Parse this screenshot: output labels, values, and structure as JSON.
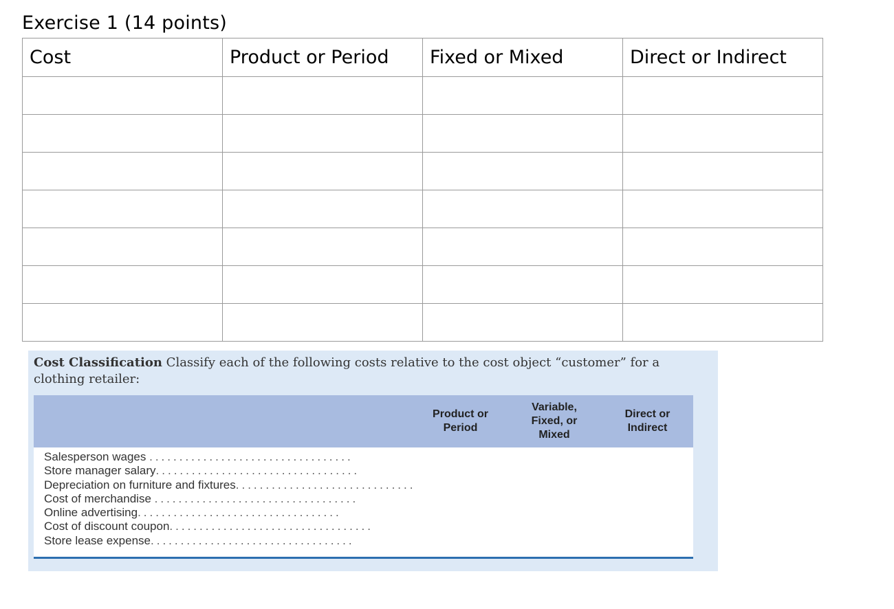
{
  "title": "Exercise 1 (14 points)",
  "answer_table": {
    "headers": [
      "Cost",
      "Product or Period",
      "Fixed or Mixed",
      "Direct or Indirect"
    ],
    "rows": [
      [
        "",
        "",
        "",
        ""
      ],
      [
        "",
        "",
        "",
        ""
      ],
      [
        "",
        "",
        "",
        ""
      ],
      [
        "",
        "",
        "",
        ""
      ],
      [
        "",
        "",
        "",
        ""
      ],
      [
        "",
        "",
        "",
        ""
      ],
      [
        "",
        "",
        "",
        ""
      ]
    ]
  },
  "problem": {
    "heading": "Cost Classification",
    "text": "Classify each of the following costs relative to the cost object “customer” for a clothing retailer:",
    "columns": [
      "Product or Period",
      "Variable, Fixed, or Mixed",
      "Direct or Indirect"
    ],
    "items": [
      "Salesperson wages",
      "Store manager salary",
      "Depreciation on furniture and fixtures",
      "Cost of merchandise",
      "Online advertising",
      "Cost of discount coupon",
      "Store lease expense"
    ]
  },
  "colors": {
    "panel_background": "#dde9f6",
    "table_header": "#a8bbe0",
    "rule": "#2d6fb0"
  }
}
